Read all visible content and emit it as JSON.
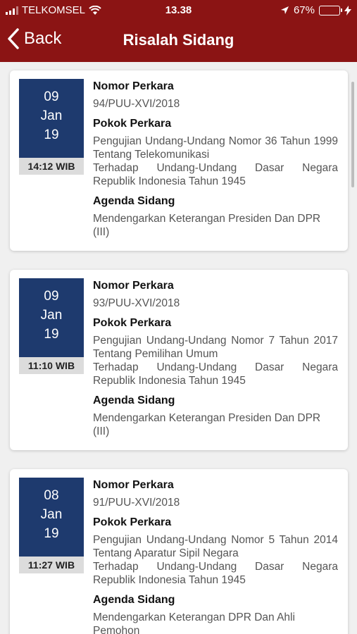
{
  "status": {
    "carrier": "TELKOMSEL",
    "time": "13.38",
    "battery": "67%"
  },
  "nav": {
    "back_label": "Back",
    "title": "Risalah Sidang"
  },
  "labels": {
    "nomor": "Nomor Perkara",
    "pokok": "Pokok Perkara",
    "agenda": "Agenda Sidang"
  },
  "cards": [
    {
      "day": "09",
      "month": "Jan",
      "year": "19",
      "time": "14:12 WIB",
      "nomor": "94/PUU-XVI/2018",
      "pokok_line1": "Pengujian Undang-Undang Nomor 36 Tahun 1999 Tentang Telekomunikasi",
      "pokok_line2": "Terhadap Undang-Undang Dasar Negara Republik Indonesia Tahun 1945",
      "agenda": "Mendengarkan Keterangan Presiden Dan DPR (III)"
    },
    {
      "day": "09",
      "month": "Jan",
      "year": "19",
      "time": "11:10 WIB",
      "nomor": "93/PUU-XVI/2018",
      "pokok_line1": "Pengujian Undang-Undang Nomor 7 Tahun 2017 Tentang Pemilihan Umum",
      "pokok_line2": "Terhadap Undang-Undang Dasar Negara Republik Indonesia Tahun 1945",
      "agenda": "Mendengarkan Keterangan Presiden Dan DPR (III)"
    },
    {
      "day": "08",
      "month": "Jan",
      "year": "19",
      "time": "11:27 WIB",
      "nomor": "91/PUU-XVI/2018",
      "pokok_line1": "Pengujian Undang-Undang Nomor 5 Tahun 2014 Tentang Aparatur Sipil Negara",
      "pokok_line2": "Terhadap Undang-Undang Dasar Negara Republik Indonesia Tahun 1945",
      "agenda": "Mendengarkan Keterangan DPR Dan Ahli Pemohon"
    }
  ]
}
